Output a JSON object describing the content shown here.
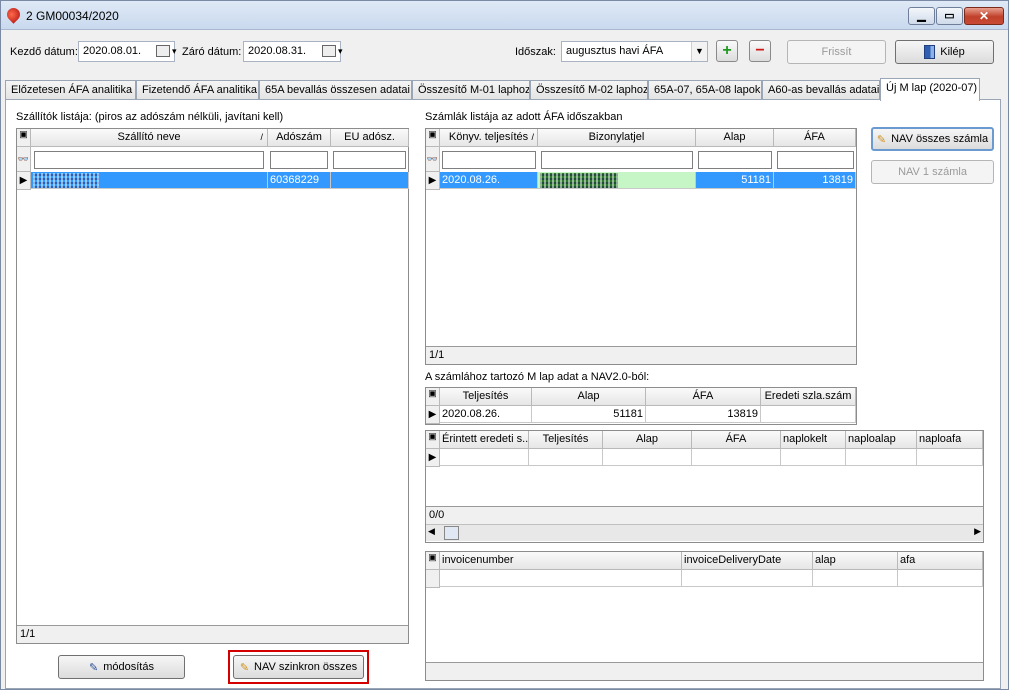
{
  "window": {
    "title": "2 GM00034/2020"
  },
  "filters": {
    "start_label": "Kezdő dátum:",
    "start_value": "2020.08.01.",
    "end_label": "Záró dátum:",
    "end_value": "2020.08.31.",
    "period_label": "Időszak:",
    "period_value": "augusztus havi ÁFA",
    "add_glyph": "+",
    "remove_glyph": "−",
    "refresh_label": "Frissít",
    "exit_label": "Kilép"
  },
  "tabs": [
    {
      "label": "Előzetesen ÁFA analitika"
    },
    {
      "label": "Fizetendő ÁFA analitika"
    },
    {
      "label": "65A bevallás összesen adatai"
    },
    {
      "label": "Összesítő M-01 laphoz"
    },
    {
      "label": "Összesítő M-02 laphoz"
    },
    {
      "label": "65A-07, 65A-08 lapok"
    },
    {
      "label": "A60-as bevallás adatai"
    },
    {
      "label": "Új M lap (2020-07)",
      "active": true
    }
  ],
  "suppliers": {
    "caption": "Szállítók listája: (piros az adószám nélküli, javítani kell)",
    "columns": [
      "Szállító neve",
      "Adószám",
      "EU adósz."
    ],
    "rows": [
      {
        "name": "",
        "tax_id": "60368229",
        "eu": ""
      }
    ],
    "status": "1/1"
  },
  "invoices": {
    "caption": "Számlák listája az adott ÁFA időszakban",
    "columns": [
      "Könyv. teljesítés",
      "Bizonylatjel",
      "Alap",
      "ÁFA"
    ],
    "rows": [
      {
        "date": "2020.08.26.",
        "doc": "",
        "base": "51181",
        "vat": "13819"
      }
    ],
    "status": "1/1"
  },
  "nav_buttons": {
    "all_invoices": "NAV összes számla",
    "one_invoice": "NAV 1 számla"
  },
  "mlap": {
    "caption": "A számlához tartozó M lap adat a NAV2.0-ból:",
    "columns": [
      "Teljesítés",
      "Alap",
      "ÁFA",
      "Eredeti szla.szám"
    ],
    "rows": [
      {
        "date": "2020.08.26.",
        "base": "51181",
        "vat": "13819",
        "orig": ""
      }
    ]
  },
  "affected": {
    "columns": [
      "Érintett eredeti s...",
      "Teljesítés",
      "Alap",
      "ÁFA",
      "naplokelt",
      "naploalap",
      "naploafa"
    ],
    "status": "0/0"
  },
  "invoice_detail": {
    "columns": [
      "invoicenumber",
      "invoiceDeliveryDate",
      "alap",
      "afa"
    ]
  },
  "bottom_buttons": {
    "modify": "módosítás",
    "sync_all": "NAV szinkron összes"
  },
  "colors": {
    "selection": "#3399ff",
    "highlight_outline": "#d40000",
    "doc_cell_green": "#c6f5c6"
  }
}
